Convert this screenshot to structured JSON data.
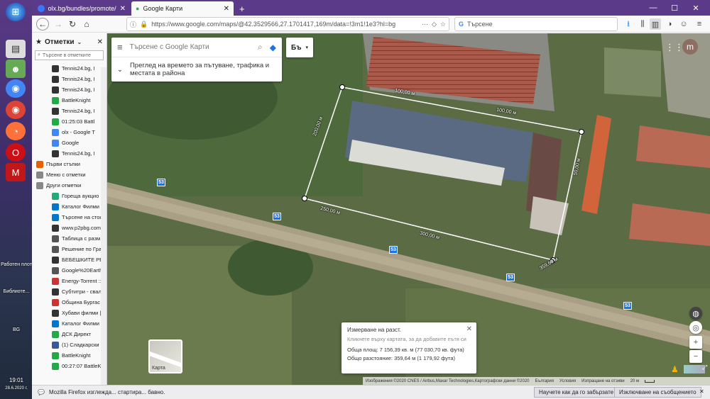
{
  "taskbar": {
    "items": [
      {
        "icon": "start-orb-icon",
        "label": ""
      },
      {
        "icon": "file-icon",
        "label": ""
      },
      {
        "icon": "folder-icon",
        "label": ""
      },
      {
        "icon": "chrome-icon",
        "label": ""
      },
      {
        "icon": "chrome-icon",
        "label": ""
      },
      {
        "icon": "firefox-icon",
        "label": ""
      },
      {
        "icon": "opera-icon",
        "label": ""
      },
      {
        "icon": "mcafee-icon",
        "label": ""
      }
    ],
    "desktop_label_1": "Работен плот",
    "desktop_label_2": "Библиоте...",
    "lang": "BG",
    "clock_time": "19:01",
    "clock_date": "28.6.2020 г."
  },
  "browser": {
    "tabs": [
      {
        "title": "olx.bg/bundles/promote/?id=",
        "active": false
      },
      {
        "title": "Google Карти",
        "active": true
      }
    ],
    "new_tab": "+",
    "url": "https://www.google.com/maps/@42.3529566,27.1701417,169m/data=!3m1!1e3?hl=bg",
    "search_placeholder": "Търсене",
    "controls": {
      "minimize": "—",
      "maximize": "☐",
      "close": "✕"
    }
  },
  "sidebar": {
    "title": "Отметки",
    "search_placeholder": "Търсене в отметките",
    "items": [
      {
        "label": "Tennis24.bg, I",
        "color": "#333"
      },
      {
        "label": "Tennis24.bg, I",
        "color": "#333"
      },
      {
        "label": "Tennis24.bg, I",
        "color": "#333"
      },
      {
        "label": "BattleKnight",
        "color": "#2a4"
      },
      {
        "label": "Tennis24.bg, I",
        "color": "#333"
      },
      {
        "label": "01:25:03 Battl",
        "color": "#2a4"
      },
      {
        "label": "olx - Google T",
        "color": "#4285f4"
      },
      {
        "label": "Google",
        "color": "#4285f4"
      },
      {
        "label": "Tennis24.bg, I",
        "color": "#333"
      },
      {
        "label": "Първи стъпки",
        "color": "#e66000"
      },
      {
        "label": "Меню с отметки",
        "color": "#888"
      },
      {
        "label": "Други отметки",
        "color": "#888"
      },
      {
        "label": "Гореща аукцио",
        "color": "#2a7"
      },
      {
        "label": "Каталог Филми",
        "color": "#07c"
      },
      {
        "label": "Търсене на сток",
        "color": "#07c"
      },
      {
        "label": "www.p2pbg.com",
        "color": "#333"
      },
      {
        "label": "Таблица с разм",
        "color": "#555"
      },
      {
        "label": "Решение по Гра",
        "color": "#555"
      },
      {
        "label": "БЕБЕШКИТЕ РЕЦ",
        "color": "#333"
      },
      {
        "label": "Google%20Earth.",
        "color": "#555"
      },
      {
        "label": "Energy-Torrent ::",
        "color": "#c33"
      },
      {
        "label": "Субтитри - свал",
        "color": "#333"
      },
      {
        "label": "Община Бургас",
        "color": "#c33"
      },
      {
        "label": "Хубави филми |",
        "color": "#333"
      },
      {
        "label": "Каталог Филми",
        "color": "#07c"
      },
      {
        "label": "ДСК Директ",
        "color": "#2a4"
      },
      {
        "label": "(1) Сладкарски б",
        "color": "#3b5998"
      },
      {
        "label": "BattleKnight",
        "color": "#2a4"
      },
      {
        "label": "00:27:07 BattleKn",
        "color": "#2a4"
      }
    ]
  },
  "map": {
    "search_placeholder": "Търсене с Google Карти",
    "traffic_line1": "Преглед на времето за пътуване, трафика и",
    "traffic_line2": "местата в района",
    "layers_label": "Бъ",
    "avatar_letter": "m",
    "route_number": "53",
    "measurements": {
      "top1": "100,00 м",
      "top2": "100,00 м",
      "left": "200,00 м",
      "right": "50,00 м",
      "bottom1": "250,00 м",
      "bottom2": "300,00 м",
      "bottom3": "359,63 м"
    },
    "measure_card": {
      "title": "Измерване на разст.",
      "hint": "Кликнете върху картата, за да добавите пътя си",
      "area": "Обща площ: 7 156,39 кв. м (77 030,70 кв. фута)",
      "distance": "Общо разстояние: 359,64 м (1 179,92 фута)"
    },
    "satellite_label": "Карта",
    "attribution": {
      "imagery": "Изображения ©2020 CNES / Airbus,Maxar Technologies,Картографски данни ©2020",
      "country": "България",
      "terms": "Условия",
      "feedback": "Изпращане на отзиви",
      "scale": "20 м"
    }
  },
  "notification": {
    "text": "Mozilla Firefox изглежда... стартира... бавно.",
    "learn_button": "Научете как да го забързате",
    "disable_button": "Изключване на съобщението"
  }
}
